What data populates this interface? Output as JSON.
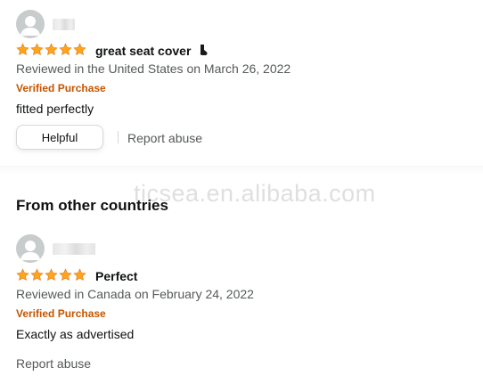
{
  "review1": {
    "title": "great seat cover",
    "meta": "Reviewed in the United States on March 26, 2022",
    "verified": "Verified Purchase",
    "body": "fitted perfectly",
    "rating": 5,
    "title_emoji_icon": "sock-icon"
  },
  "actions": {
    "helpful_label": "Helpful",
    "report_label": "Report abuse"
  },
  "section": {
    "heading": "From other countries"
  },
  "review2": {
    "title": "Perfect",
    "meta": "Reviewed in Canada on February 24, 2022",
    "verified": "Verified Purchase",
    "body": "Exactly as advertised",
    "rating": 5,
    "report_label": "Report abuse"
  },
  "watermark": {
    "text": "ticsea.en.alibaba.com"
  },
  "colors": {
    "star": "#ffa41c",
    "verified": "#c45500",
    "muted": "#565959"
  }
}
